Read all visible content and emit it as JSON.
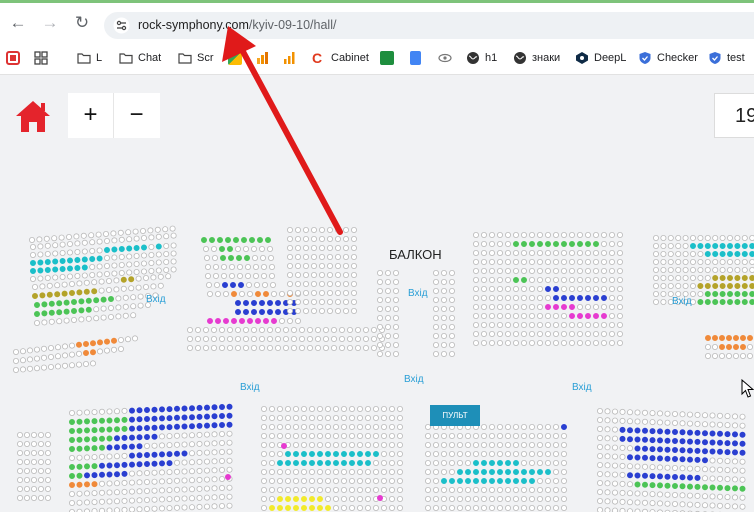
{
  "browser": {
    "url_domain": "rock-symphony.com",
    "url_path": "/kyiv-09-10/hall/"
  },
  "bookmarks": [
    {
      "label": "L",
      "icon": "folder-icon"
    },
    {
      "label": "Chat",
      "icon": "folder-icon"
    },
    {
      "label": "Scr",
      "icon": "folder-icon"
    },
    {
      "label": "Cabinet",
      "icon": "c-logo-icon"
    },
    {
      "label": "h1",
      "icon": "globe-icon"
    },
    {
      "label": "знаки",
      "icon": "globe-icon"
    },
    {
      "label": "DeepL",
      "icon": "deepl-icon"
    },
    {
      "label": "Checker",
      "icon": "shield-icon"
    },
    {
      "label": "test",
      "icon": "shield-icon"
    }
  ],
  "hall": {
    "zoom_in": "+",
    "zoom_out": "−",
    "right_value": "19",
    "balcony": "БАЛКОН",
    "entrance": "Вхід",
    "pult": "ПУЛЬТ"
  },
  "colors": {
    "seat_free": "#d9d9d9",
    "teal": "#1bbfc9",
    "green": "#4cc456",
    "olive": "#b4a32a",
    "orange": "#f08a3a",
    "magenta": "#e63bd0",
    "blue": "#2a3fd1",
    "yellow": "#f2ea2d",
    "home": "#e4242c",
    "arrow": "#e01a1a"
  }
}
